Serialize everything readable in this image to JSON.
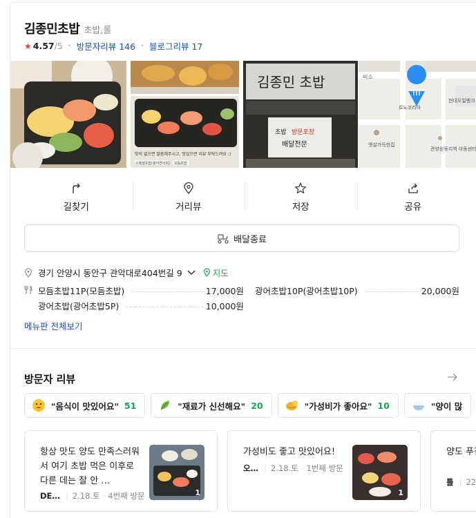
{
  "place": {
    "name": "김종민초밥",
    "category": "초밥,롤",
    "rating": "4.57",
    "rating_max": "/5",
    "visitor_reviews_label": "방문자리뷰",
    "visitor_reviews_count": "146",
    "blog_reviews_label": "블로그리뷰",
    "blog_reviews_count": "17"
  },
  "photos": {
    "sign_text": "김종민 초밥",
    "poster_text_1": "초밥",
    "poster_text_2": "방문포장",
    "poster_text_3": "배달전문",
    "caption_text": "맛이 없으면 말씀해주시고, 맛있으면 리뷰 부탁드려요 :)",
    "sticker_1": "스페셜초밥(광어연어회)",
    "sticker_2": "모듬초밥",
    "map_labels": [
      "비소",
      "르노코리아",
      "현대오일뱅크 셀프",
      "옛살가득한집",
      "관양원동지역 아동센터"
    ],
    "photo_count": "1"
  },
  "actions": [
    {
      "label": "길찾기",
      "icon": "directions-icon"
    },
    {
      "label": "거리뷰",
      "icon": "pin-icon"
    },
    {
      "label": "저장",
      "icon": "star-icon"
    },
    {
      "label": "공유",
      "icon": "share-icon"
    }
  ],
  "delivery": {
    "label": "배달종료"
  },
  "address": {
    "text": "경기 안양시 동안구 관악대로404번길 9",
    "map_link": "지도"
  },
  "menu": {
    "items": [
      {
        "name": "모듬초밥11P(모듬초밥)",
        "price": "17,000원"
      },
      {
        "name": "광어초밥10P(광어초밥10P)",
        "price": "20,000원"
      },
      {
        "name": "광어초밥(광어초밥5P)",
        "price": "10,000원"
      }
    ],
    "more_label": "메뉴판 전체보기"
  },
  "visitor_section": {
    "title": "방문자 리뷰",
    "keywords": [
      {
        "text": "\"음식이 맛있어요\"",
        "count": "51"
      },
      {
        "text": "\"재료가 신선해요\"",
        "count": "20"
      },
      {
        "text": "\"가성비가 좋아요\"",
        "count": "10"
      },
      {
        "text": "\"양이 많",
        "count": ""
      }
    ],
    "reviews": [
      {
        "text": "항상 맛도 양도 만족스러워서 여기 초밥 먹은 이후로 다른 데는 잘 안 …",
        "author": "DE…",
        "date": "2.18.토",
        "visit": "4번째 방문",
        "photo_count": "1"
      },
      {
        "text": "가성비도 좋고 맛있어요!",
        "author": "오…",
        "date": "2.18.토",
        "visit": "1번째 방문",
        "photo_count": "1"
      },
      {
        "text": "양도 푸짐하고 맛있어요",
        "author": "틀",
        "date": "22.1",
        "visit": "",
        "photo_count": ""
      }
    ]
  }
}
